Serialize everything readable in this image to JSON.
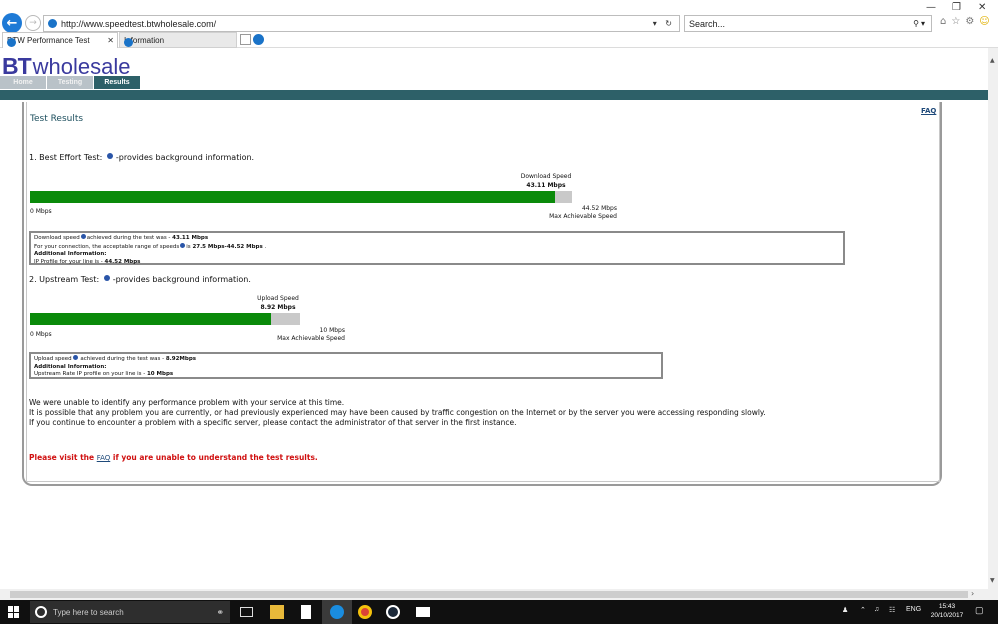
{
  "browser": {
    "url": "http://www.speedtest.btwholesale.com/",
    "search_placeholder": "Search...",
    "tabs": [
      {
        "label": "BTW Performance Test",
        "active": true
      },
      {
        "label": "Information",
        "active": false
      }
    ],
    "accent": "#1e7ad6"
  },
  "site": {
    "logo_bt": "BT",
    "logo_word": "wholesale",
    "nav": [
      "Home",
      "Testing",
      "Results"
    ],
    "active_nav": "Results",
    "theme_color": "#2d6068"
  },
  "results": {
    "faq_link": "FAQ",
    "title": "Test Results",
    "section1": {
      "heading_pre": "1. Best Effort Test:",
      "heading_post": "-provides background information.",
      "speed_label": "Download Speed",
      "speed_value": "43.11 Mbps",
      "min_label": "0 Mbps",
      "max_value": "44.52 Mbps",
      "max_label": "Max Achievable Speed",
      "fill_fraction": 0.968,
      "info": {
        "line1_pre": "Download speed",
        "line1_mid": "achieved during the test was - ",
        "line1_val": "43.11 Mbps",
        "line2_pre": "For your connection, the acceptable range of speeds",
        "line2_mid": "is ",
        "line2_val": "27.5 Mbps-44.52 Mbps",
        "line2_end": " .",
        "line3": "Additional Information:",
        "line4_pre": "IP Profile for your line is - ",
        "line4_val": "44.52 Mbps"
      }
    },
    "section2": {
      "heading_pre": "2. Upstream Test:",
      "heading_post": "-provides background information.",
      "speed_label": "Upload Speed",
      "speed_value": "8.92 Mbps",
      "min_label": "0 Mbps",
      "max_value": "10 Mbps",
      "max_label": "Max Achievable Speed",
      "fill_fraction": 0.892,
      "info": {
        "line1_pre": "Upload speed",
        "line1_mid": " achieved during the test was - ",
        "line1_val": "8.92Mbps",
        "line2": "Additional Information:",
        "line3_pre": "Upstream Rate IP profile on your line is - ",
        "line3_val": "10 Mbps"
      }
    },
    "message": [
      "We were unable to identify any performance problem with your service at this time.",
      "It is possible that any problem you are currently, or had previously experienced may have been caused by traffic congestion on the Internet or by the server you were accessing responding slowly.",
      "If you continue to encounter a problem with a specific server, please contact the administrator of that server in the first instance."
    ],
    "faq_message_pre": "Please visit the ",
    "faq_message_link": "FAQ",
    "faq_message_post": " if you are unable to understand the test results.",
    "bar_color": "#0a8a0a",
    "alert_color": "#d01010"
  },
  "taskbar": {
    "search_placeholder": "Type here to search",
    "lang": "ENG",
    "time": "15:43",
    "date": "20/10/2017"
  }
}
